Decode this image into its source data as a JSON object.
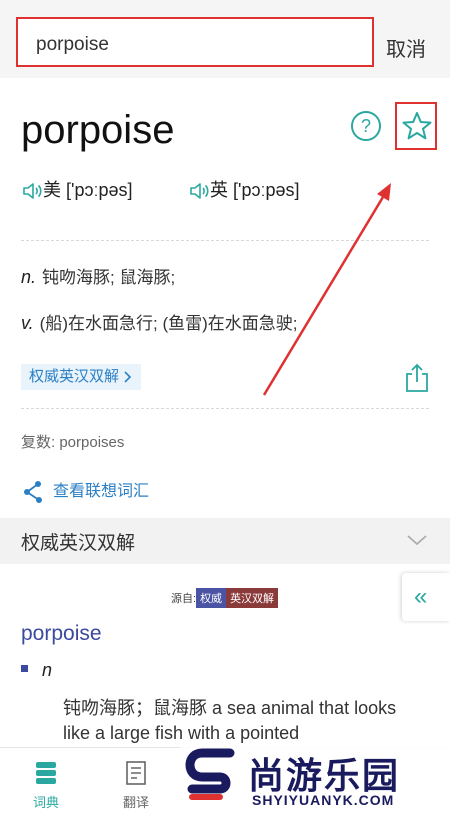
{
  "search": {
    "value": "porpoise",
    "cancel_label": "取消"
  },
  "entry": {
    "word": "porpoise",
    "pronunciations": [
      {
        "label": "美",
        "ipa": "['pɔːpəs]"
      },
      {
        "label": "英",
        "ipa": "['pɔːpəs]"
      }
    ],
    "definitions": [
      {
        "pos": "n.",
        "text": "钝吻海豚; 鼠海豚;"
      },
      {
        "pos": "v.",
        "text": "(船)在水面急行; (鱼雷)在水面急驶;"
      }
    ],
    "authority_badge": "权威英汉双解",
    "plural": "复数: porpoises",
    "assoc_label": "查看联想词汇"
  },
  "section": {
    "title": "权威英汉双解",
    "source_prefix": "源自:",
    "source_tag1": "权威",
    "source_tag2": "英汉双解",
    "side_tab": "«",
    "entry_word": "porpoise",
    "pos": "n",
    "text": "钝吻海豚；鼠海豚 a sea animal that looks like a large fish with a pointed"
  },
  "nav": [
    {
      "label": "词典",
      "icon": "dictionary-icon",
      "active": true
    },
    {
      "label": "翻译",
      "icon": "translate-icon",
      "active": false
    }
  ],
  "watermark": {
    "text_cn": "尚游乐园",
    "text_en": "SHYIYUANYK.COM"
  },
  "colors": {
    "accent": "#2aa8a0",
    "link": "#2b7fc4",
    "annotation": "#e03131",
    "entry_blue": "#3b4aa0"
  }
}
